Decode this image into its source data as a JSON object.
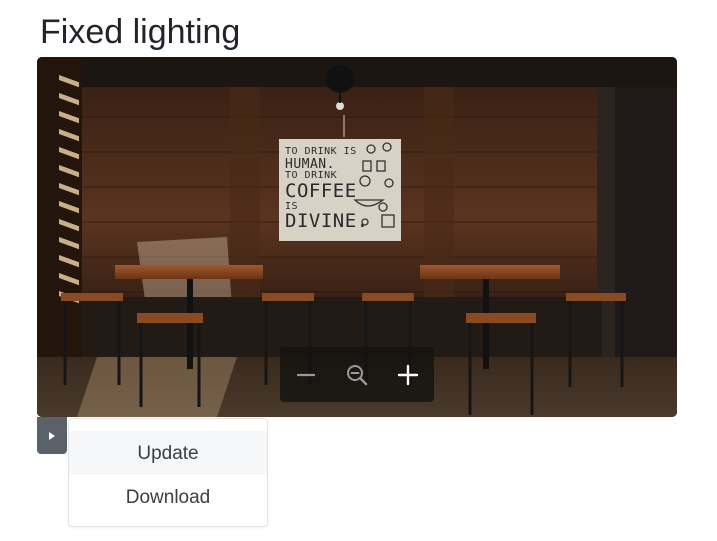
{
  "page": {
    "title": "Fixed lighting"
  },
  "image": {
    "alt": "",
    "poster": {
      "line1": "TO DRINK IS",
      "line2": "HUMAN.",
      "line3": "TO DRINK",
      "line4": "COFFEE",
      "line5": "IS",
      "line6": "DIVINE."
    }
  },
  "zoom_controls": {
    "zoom_out_icon": "minus-icon",
    "reset_icon": "magnifier-minus-icon",
    "zoom_in_icon": "plus-icon"
  },
  "menu": {
    "toggle_icon": "caret-right-icon",
    "items": [
      {
        "label": "Update"
      },
      {
        "label": "Download"
      }
    ]
  },
  "colors": {
    "toolbar_bg": "#141210",
    "toggle_bg": "#5a6169",
    "hover_item_bg": "#f6f7f8"
  }
}
